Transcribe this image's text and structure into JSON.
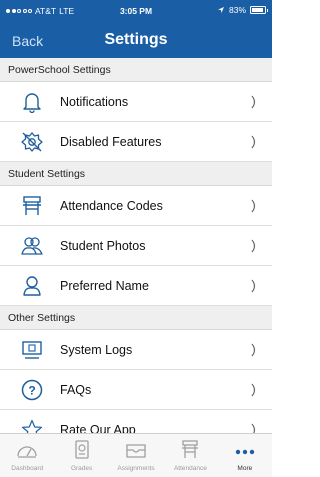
{
  "status_bar": {
    "carrier": "AT&T",
    "network": "LTE",
    "time": "3:05 PM",
    "battery_pct": "83%"
  },
  "nav": {
    "back_label": "Back",
    "title": "Settings"
  },
  "sections": [
    {
      "header": "PowerSchool Settings",
      "items": [
        {
          "label": "Notifications",
          "icon": "bell-icon"
        },
        {
          "label": "Disabled Features",
          "icon": "gear-off-icon"
        }
      ]
    },
    {
      "header": "Student Settings",
      "items": [
        {
          "label": "Attendance Codes",
          "icon": "desk-icon"
        },
        {
          "label": "Student Photos",
          "icon": "people-icon"
        },
        {
          "label": "Preferred Name",
          "icon": "person-icon"
        }
      ]
    },
    {
      "header": "Other Settings",
      "items": [
        {
          "label": "System Logs",
          "icon": "monitor-icon"
        },
        {
          "label": "FAQs",
          "icon": "question-icon"
        },
        {
          "label": "Rate Our App",
          "icon": "star-icon"
        }
      ]
    }
  ],
  "tabs": [
    {
      "label": "Dashboard",
      "icon": "dashboard-icon"
    },
    {
      "label": "Grades",
      "icon": "grades-icon"
    },
    {
      "label": "Assignments",
      "icon": "assignments-icon"
    },
    {
      "label": "Attendance",
      "icon": "attendance-icon"
    },
    {
      "label": "More",
      "icon": "more-icon",
      "active": true
    }
  ],
  "colors": {
    "nav_bg": "#1a5fa6",
    "icon": "#1f5f9e",
    "section_bg": "#efefef"
  }
}
